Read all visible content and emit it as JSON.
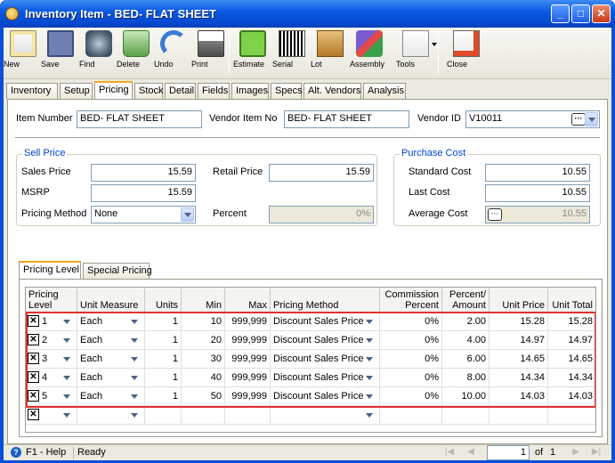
{
  "window": {
    "title": "Inventory Item - BED- FLAT SHEET",
    "min_glyph": "_",
    "max_glyph": "□",
    "close_glyph": "✕"
  },
  "toolbar": [
    {
      "label": "New",
      "icon": "new-icon"
    },
    {
      "label": "Save",
      "icon": "save-icon"
    },
    {
      "label": "Find",
      "icon": "find-icon"
    },
    {
      "label": "Delete",
      "icon": "delete-icon"
    },
    {
      "label": "Undo",
      "icon": "undo-icon"
    },
    {
      "label": "Print",
      "icon": "print-icon"
    },
    {
      "label": "Estimate",
      "icon": "estimate-icon"
    },
    {
      "label": "Serial",
      "icon": "serial-icon"
    },
    {
      "label": "Lot",
      "icon": "lot-icon"
    },
    {
      "label": "Assembly",
      "icon": "assembly-icon"
    },
    {
      "label": "Tools",
      "icon": "tools-icon"
    },
    {
      "label": "Close",
      "icon": "close-icon"
    }
  ],
  "tabs": [
    "Inventory",
    "Setup",
    "Pricing",
    "Stock",
    "Detail",
    "Fields",
    "Images",
    "Specs",
    "Alt. Vendors",
    "Analysis"
  ],
  "active_tab": "Pricing",
  "header": {
    "item_number_label": "Item Number",
    "item_number": "BED- FLAT SHEET",
    "vendor_item_label": "Vendor Item No",
    "vendor_item": "BED- FLAT SHEET",
    "vendor_id_label": "Vendor ID",
    "vendor_id": "V10011"
  },
  "sell_price": {
    "title": "Sell Price",
    "sales_price_label": "Sales Price",
    "sales_price": "15.59",
    "retail_price_label": "Retail Price",
    "retail_price": "15.59",
    "msrp_label": "MSRP",
    "msrp": "15.59",
    "pricing_method_label": "Pricing Method",
    "pricing_method": "None",
    "percent_label": "Percent",
    "percent": "0%"
  },
  "purchase_cost": {
    "title": "Purchase Cost",
    "standard_cost_label": "Standard Cost",
    "standard_cost": "10.55",
    "last_cost_label": "Last Cost",
    "last_cost": "10.55",
    "average_cost_label": "Average Cost",
    "average_cost": "10.55"
  },
  "subtabs": [
    "Pricing Level",
    "Special Pricing"
  ],
  "grid": {
    "columns": [
      {
        "label": "Pricing\nLevel"
      },
      {
        "label": "Unit Measure"
      },
      {
        "label": "Units"
      },
      {
        "label": "Min"
      },
      {
        "label": "Max"
      },
      {
        "label": "Pricing Method"
      },
      {
        "label": "Commission\nPercent"
      },
      {
        "label": "Percent/\nAmount"
      },
      {
        "label": "Unit Price"
      },
      {
        "label": "Unit Total"
      }
    ],
    "rows": [
      {
        "level": "1",
        "unit": "Each",
        "units": "1",
        "min": "10",
        "max": "999,999",
        "method": "Discount Sales Price",
        "commission": "0%",
        "pct": "2.00",
        "price": "15.28",
        "total": "15.28"
      },
      {
        "level": "2",
        "unit": "Each",
        "units": "1",
        "min": "20",
        "max": "999,999",
        "method": "Discount Sales Price",
        "commission": "0%",
        "pct": "4.00",
        "price": "14.97",
        "total": "14.97"
      },
      {
        "level": "3",
        "unit": "Each",
        "units": "1",
        "min": "30",
        "max": "999,999",
        "method": "Discount Sales Price",
        "commission": "0%",
        "pct": "6.00",
        "price": "14.65",
        "total": "14.65"
      },
      {
        "level": "4",
        "unit": "Each",
        "units": "1",
        "min": "40",
        "max": "999,999",
        "method": "Discount Sales Price",
        "commission": "0%",
        "pct": "8.00",
        "price": "14.34",
        "total": "14.34"
      },
      {
        "level": "5",
        "unit": "Each",
        "units": "1",
        "min": "50",
        "max": "999,999",
        "method": "Discount Sales Price",
        "commission": "0%",
        "pct": "10.00",
        "price": "14.03",
        "total": "14.03"
      }
    ],
    "delete_glyph": "✕"
  },
  "status": {
    "help": "F1 - Help",
    "state": "Ready",
    "page": "1",
    "of_label": "of",
    "total_pages": "1"
  }
}
